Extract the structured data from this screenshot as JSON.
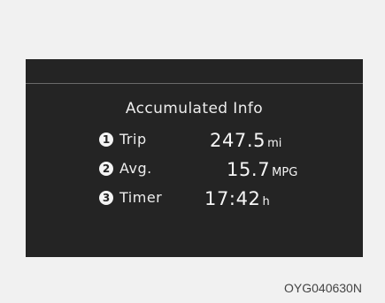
{
  "display": {
    "title": "Accumulated Info",
    "rows": [
      {
        "badge": "1",
        "label": "Trip",
        "value": "247.5",
        "unit": "mi"
      },
      {
        "badge": "2",
        "label": "Avg.",
        "value": "15.7",
        "unit": "MPG"
      },
      {
        "badge": "3",
        "label": "Timer",
        "value": "17:42",
        "unit": "h"
      }
    ]
  },
  "footer": {
    "code": "OYG040630N"
  }
}
